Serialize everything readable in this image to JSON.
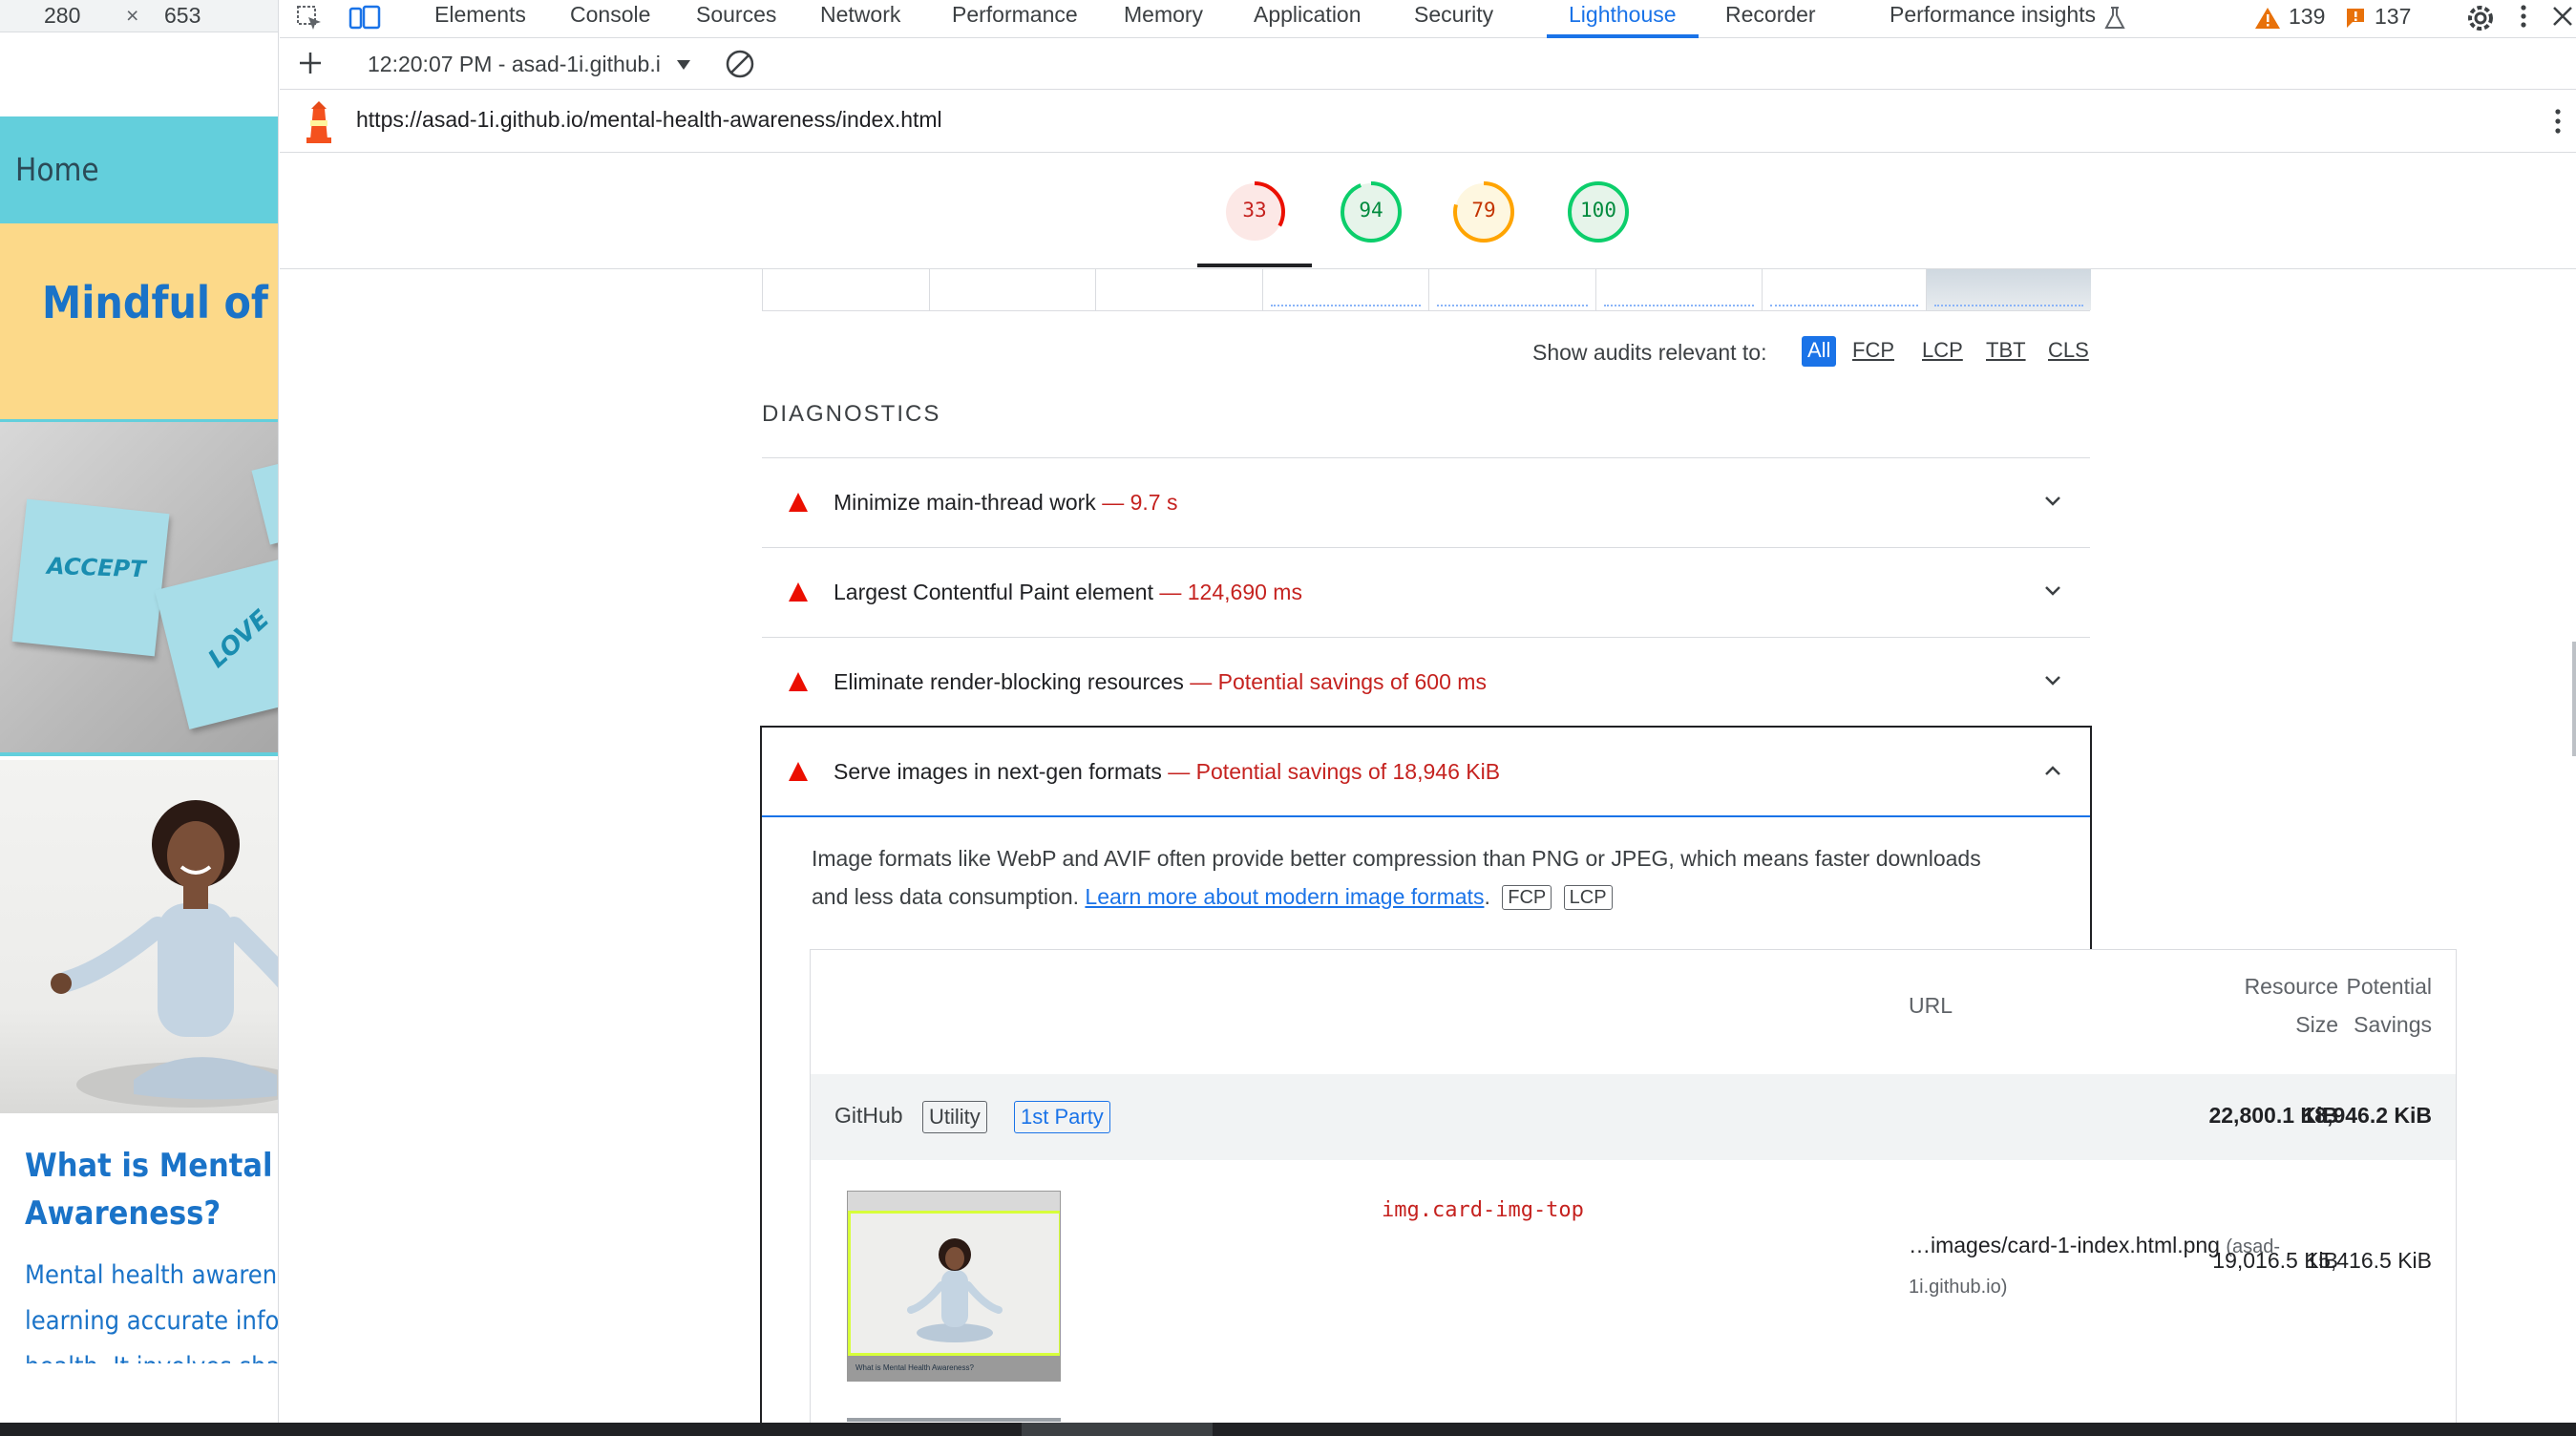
{
  "viewport": {
    "width": "280",
    "times": "×",
    "height": "653"
  },
  "site": {
    "nav_home": "Home",
    "brand": "Mindful of Me",
    "note1": "ACCEPT",
    "note2": "LOVE",
    "heading_line1": "What is Mental Health",
    "heading_line2": "Awareness?",
    "para_line1": "Mental health awareness is",
    "para_line2": "learning accurate information",
    "para_line3": "health. It involves sharing"
  },
  "devtools": {
    "tabs": [
      "Elements",
      "Console",
      "Sources",
      "Network",
      "Performance",
      "Memory",
      "Application",
      "Security",
      "Lighthouse",
      "Recorder",
      "Performance insights"
    ],
    "active_tab": "Lighthouse",
    "warnings_count": "139",
    "issues_count": "137",
    "report_selector": "12:20:07 PM - asad-1i.github.i",
    "report_url": "https://asad-1i.github.io/mental-health-awareness/index.html"
  },
  "scores": [
    {
      "value": "33",
      "color": "#eb0f00",
      "bg": "#fce8e6"
    },
    {
      "value": "94",
      "color": "#0cce6b",
      "bg": "#e6f4ea"
    },
    {
      "value": "79",
      "color": "#ffa400",
      "bg": "#fef7e0"
    },
    {
      "value": "100",
      "color": "#0cce6b",
      "bg": "#e6f4ea"
    }
  ],
  "filter": {
    "label": "Show audits relevant to:",
    "options": [
      "All",
      "FCP",
      "LCP",
      "TBT",
      "CLS"
    ],
    "active": "All"
  },
  "diagnostics_title": "DIAGNOSTICS",
  "audits": [
    {
      "title": "Minimize main-thread work",
      "sep": "—",
      "value": "9.7 s"
    },
    {
      "title": "Largest Contentful Paint element",
      "sep": "—",
      "value": "124,690 ms"
    },
    {
      "title": "Eliminate render-blocking resources",
      "sep": "—",
      "value": "Potential savings of 600 ms"
    },
    {
      "title": "Serve images in next-gen formats",
      "sep": "—",
      "value": "Potential savings of 18,946 KiB"
    }
  ],
  "expanded": {
    "desc_line1": "Image formats like WebP and AVIF often provide better compression than PNG or JPEG, which means faster downloads",
    "desc_line2_prefix": "and less data consumption. ",
    "link": "Learn more about modern image formats",
    "desc_suffix": ".",
    "badges": [
      "FCP",
      "LCP"
    ]
  },
  "table": {
    "col_url": "URL",
    "col_size_1": "Resource",
    "col_size_2": "Size",
    "col_savings_1": "Potential",
    "col_savings_2": "Savings",
    "group": {
      "name": "GitHub",
      "badge1": "Utility",
      "badge2": "1st Party",
      "size": "22,800.1 KiB",
      "savings": "18,946.2 KiB"
    },
    "item": {
      "selector": "img.card-img-top",
      "url": "…images/card-1-index.html.png",
      "host_part1": "(asad-",
      "host_part2": "1i.github.io)",
      "size": "19,016.5 KiB",
      "savings": "15,416.5 KiB",
      "thumb_caption": "What is Mental Health Awareness?"
    }
  }
}
